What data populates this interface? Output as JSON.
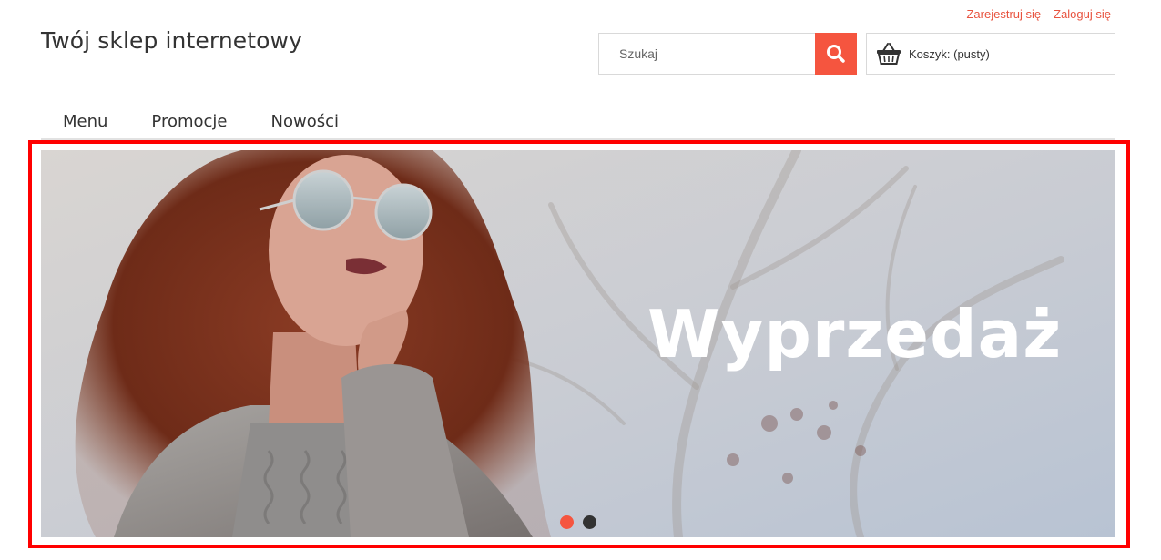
{
  "header": {
    "register_link": "Zarejestruj się",
    "login_link": "Zaloguj się",
    "store_title": "Twój sklep internetowy"
  },
  "search": {
    "placeholder": "Szukaj",
    "value": "",
    "button_icon": "search-icon"
  },
  "cart": {
    "icon": "basket-icon",
    "label": "Koszyk: (pusty)"
  },
  "nav": {
    "items": [
      {
        "label": "Menu"
      },
      {
        "label": "Promocje"
      },
      {
        "label": "Nowości"
      }
    ]
  },
  "banner": {
    "headline": "Wyprzedaż",
    "slides_total": 2,
    "active_slide": 1
  },
  "colors": {
    "accent": "#f5553f",
    "link": "#e8533f",
    "dot_active": "#f5553f",
    "dot_inactive": "#333333",
    "highlight_frame": "#ff0000"
  }
}
